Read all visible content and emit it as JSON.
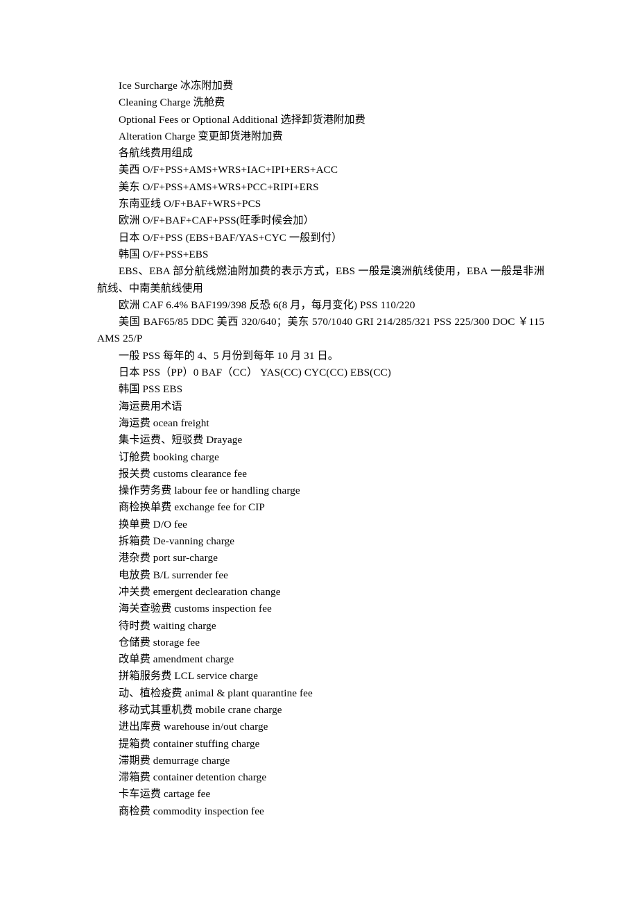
{
  "document": {
    "lines": [
      {
        "id": "ice-surcharge",
        "text": "Ice Surcharge  冰冻附加费"
      },
      {
        "id": "cleaning-charge",
        "text": "Cleaning Charge  洗舱费"
      },
      {
        "id": "optional-fees",
        "text": "Optional Fees or Optional Additional  选择卸货港附加费"
      },
      {
        "id": "alteration-charge",
        "text": "Alteration Charge  变更卸货港附加费"
      },
      {
        "id": "route-cost-heading",
        "text": "各航线费用组成"
      },
      {
        "id": "route-us-west",
        "text": "美西  O/F+PSS+AMS+WRS+IAC+IPI+ERS+ACC"
      },
      {
        "id": "route-us-east",
        "text": "美东  O/F+PSS+AMS+WRS+PCC+RIPI+ERS"
      },
      {
        "id": "route-southeast-asia",
        "text": "东南亚线  O/F+BAF+WRS+PCS"
      },
      {
        "id": "route-europe",
        "text": "欧洲  O/F+BAF+CAF+PSS(旺季时候会加）"
      },
      {
        "id": "route-japan",
        "text": "日本  O/F+PSS (EBS+BAF/YAS+CYC 一般到付）"
      },
      {
        "id": "route-korea",
        "text": "韩国  O/F+PSS+EBS"
      },
      {
        "id": "ebs-eba-note",
        "text": "EBS、EBA  部分航线燃油附加费的表示方式，EBS 一般是澳洲航线使用，EBA 一般是非洲航线、中南美航线使用"
      },
      {
        "id": "europe-rates",
        "text": "欧洲  CAF 6.4% BAF199/398  反恐 6(8 月，每月变化) PSS 110/220"
      },
      {
        "id": "usa-rates",
        "text": "美国  BAF65/85 DDC 美西 320/640；美东 570/1040 GRI 214/285/321 PSS 225/300 DOC ￥115 AMS 25/P"
      },
      {
        "id": "pss-season-note",
        "text": "一般 PSS  每年的 4、5 月份到每年 10 月 31 日。"
      },
      {
        "id": "japan-charges",
        "text": "日本  PSS（PP）0 BAF（CC）  YAS(CC) CYC(CC) EBS(CC)"
      },
      {
        "id": "korea-charges",
        "text": "韩国  PSS EBS"
      },
      {
        "id": "glossary-heading",
        "text": "海运费用术语"
      },
      {
        "id": "term-ocean-freight",
        "text": "海运费  ocean freight"
      },
      {
        "id": "term-drayage",
        "text": "集卡运费、短驳费  Drayage"
      },
      {
        "id": "term-booking-charge",
        "text": "订舱费  booking charge"
      },
      {
        "id": "term-customs-clearance",
        "text": "报关费  customs clearance fee"
      },
      {
        "id": "term-labour-fee",
        "text": "操作劳务费  labour fee or handling charge"
      },
      {
        "id": "term-exchange-cip",
        "text": "商检换单费  exchange fee for CIP"
      },
      {
        "id": "term-do-fee",
        "text": "换单费  D/O fee"
      },
      {
        "id": "term-devanning",
        "text": "拆箱费  De-vanning charge"
      },
      {
        "id": "term-port-surcharge",
        "text": "港杂费  port sur-charge"
      },
      {
        "id": "term-bl-surrender",
        "text": "电放费  B/L surrender fee"
      },
      {
        "id": "term-emergent-decl",
        "text": "冲关费  emergent declearation change"
      },
      {
        "id": "term-customs-inspection",
        "text": "海关查验费  customs inspection fee"
      },
      {
        "id": "term-waiting-charge",
        "text": "待时费  waiting charge"
      },
      {
        "id": "term-storage-fee",
        "text": "仓储费  storage fee"
      },
      {
        "id": "term-amendment-charge",
        "text": "改单费  amendment charge"
      },
      {
        "id": "term-lcl-service",
        "text": "拼箱服务费  LCL service charge"
      },
      {
        "id": "term-quarantine",
        "text": "动、植检疫费  animal & plant quarantine fee"
      },
      {
        "id": "term-mobile-crane",
        "text": "移动式其重机费  mobile crane charge"
      },
      {
        "id": "term-warehouse-inout",
        "text": "进出库费  warehouse in/out charge"
      },
      {
        "id": "term-container-stuffing",
        "text": "提箱费  container stuffing charge"
      },
      {
        "id": "term-demurrage",
        "text": "滞期费  demurrage charge"
      },
      {
        "id": "term-container-detention",
        "text": "滞箱费  container detention charge"
      },
      {
        "id": "term-cartage-fee",
        "text": "卡车运费  cartage fee"
      },
      {
        "id": "term-commodity-inspection",
        "text": "商检费  commodity inspection fee"
      }
    ]
  }
}
